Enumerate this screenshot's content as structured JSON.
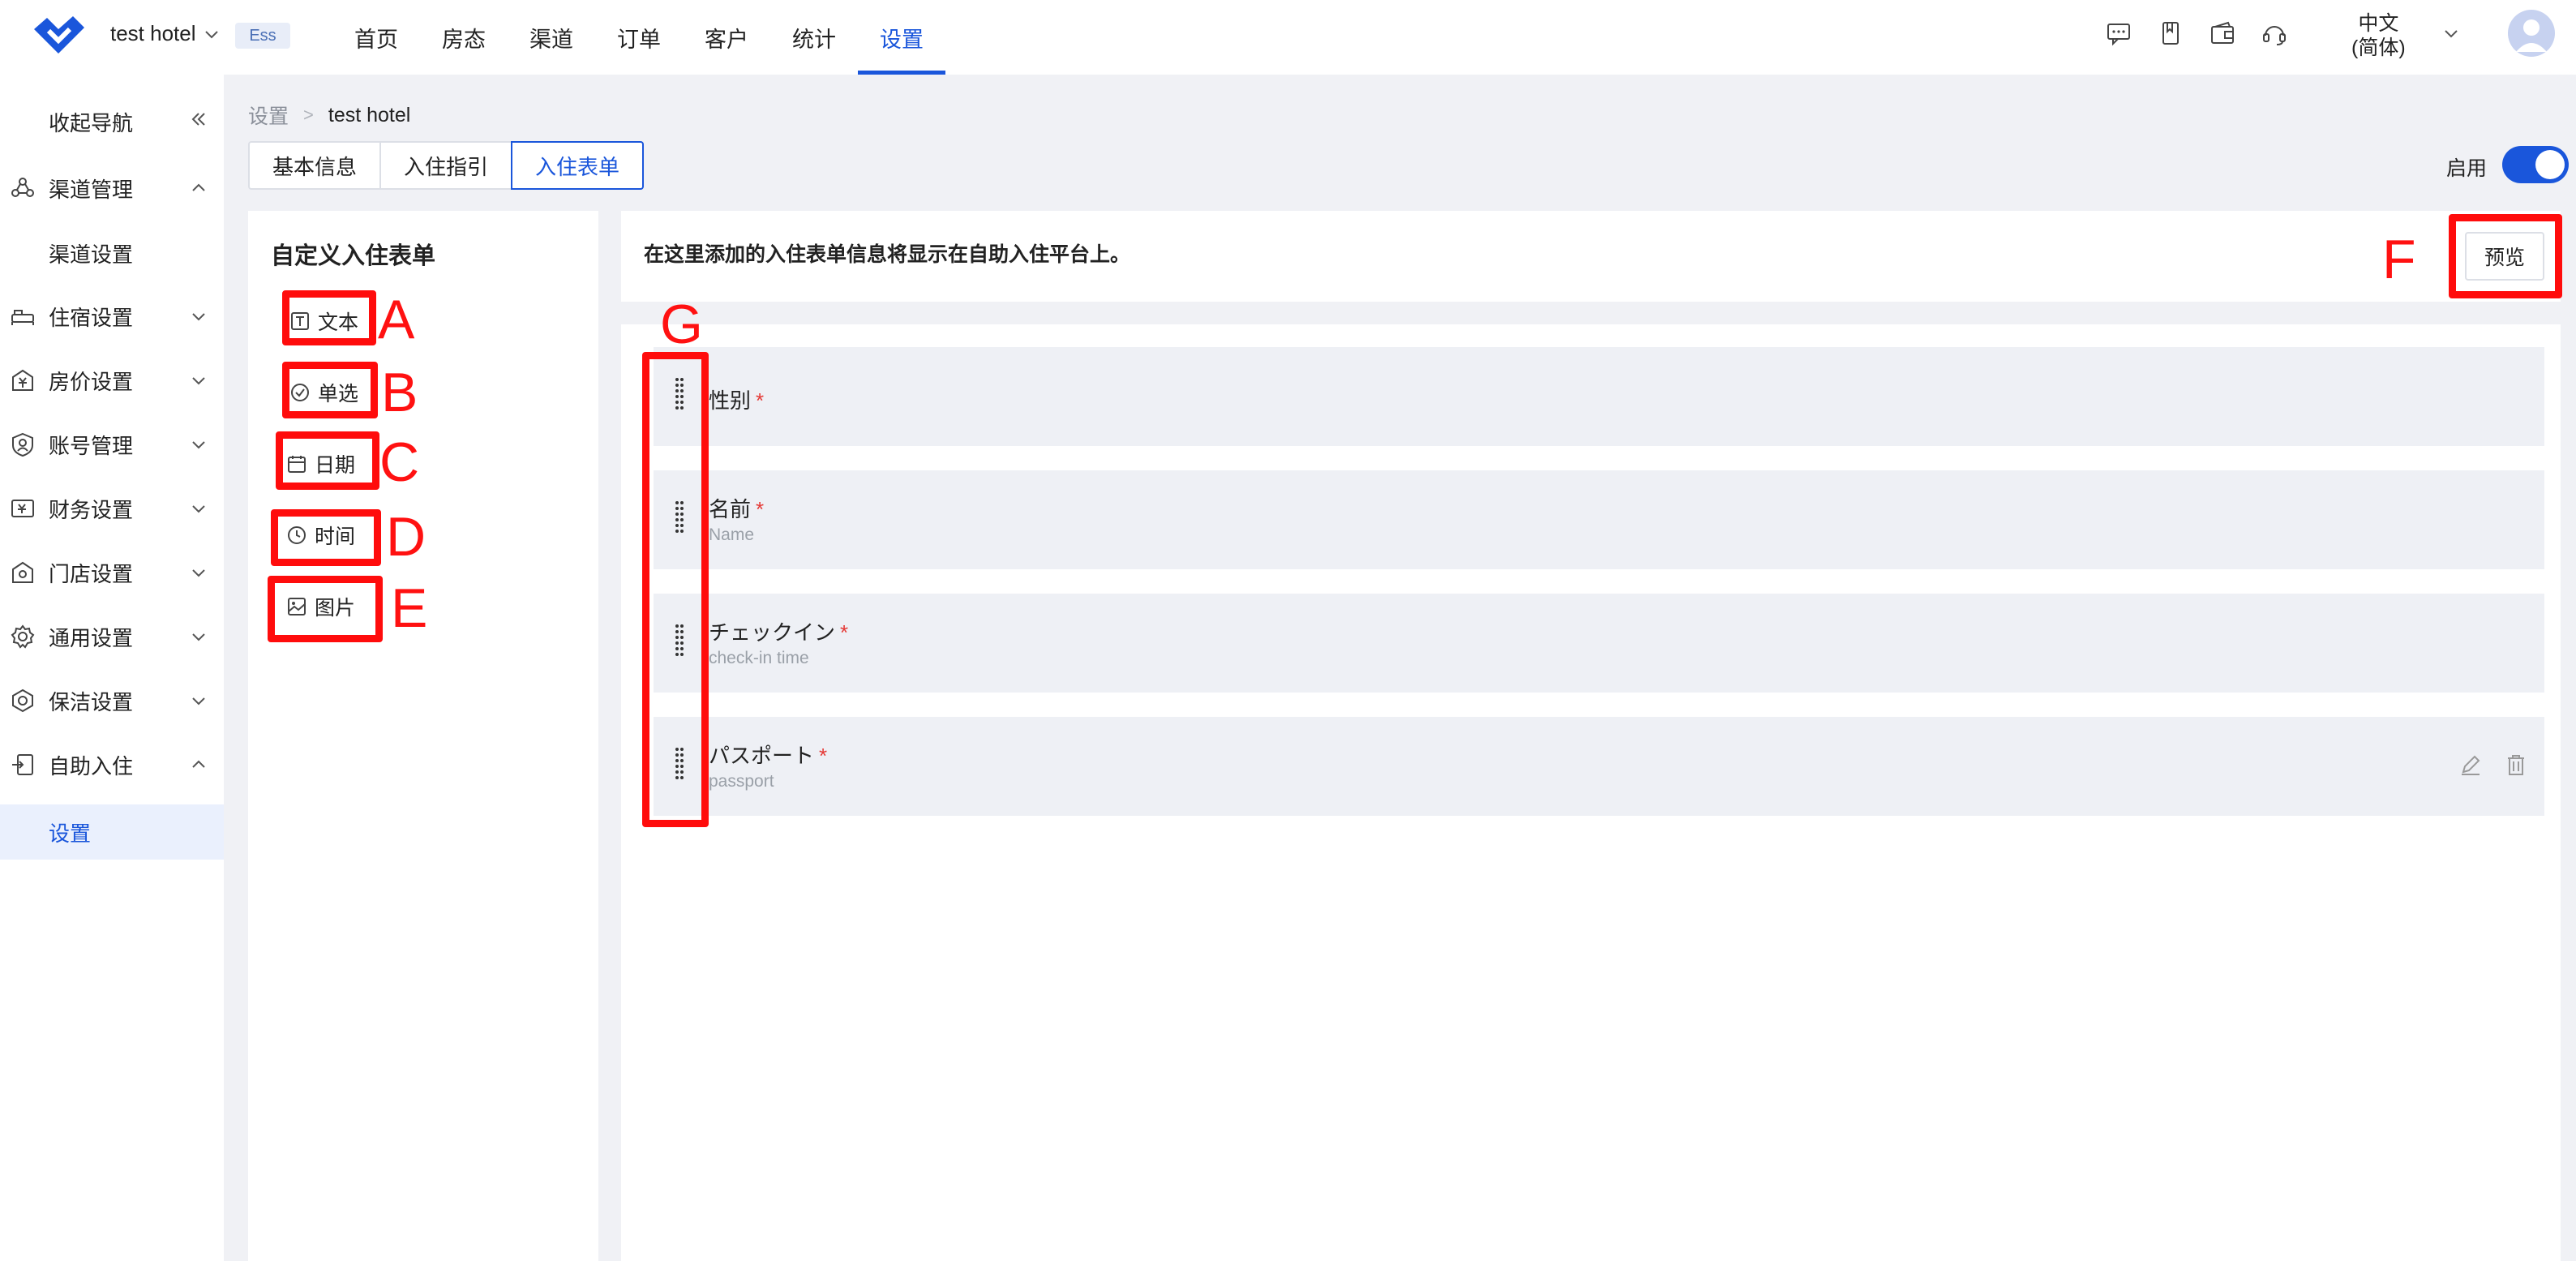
{
  "header": {
    "hotel_name": "test hotel",
    "badge": "Ess",
    "nav": [
      "首页",
      "房态",
      "渠道",
      "订单",
      "客户",
      "统计",
      "设置"
    ],
    "active_nav": "设置",
    "language_line1": "中文",
    "language_line2": "(简体)",
    "icons": [
      "message-icon",
      "bookmark-icon",
      "wallet-icon",
      "headset-icon"
    ]
  },
  "sidebar": {
    "collapse_label": "收起导航",
    "items": [
      {
        "label": "渠道管理",
        "icon": "channel-icon",
        "expanded": true
      },
      {
        "label": "渠道设置",
        "sub": true
      },
      {
        "label": "住宿设置",
        "icon": "bed-icon"
      },
      {
        "label": "房价设置",
        "icon": "price-icon"
      },
      {
        "label": "账号管理",
        "icon": "account-icon"
      },
      {
        "label": "财务设置",
        "icon": "finance-icon"
      },
      {
        "label": "门店设置",
        "icon": "store-icon"
      },
      {
        "label": "通用设置",
        "icon": "gear-icon"
      },
      {
        "label": "保洁设置",
        "icon": "cleaning-icon"
      },
      {
        "label": "自助入住",
        "icon": "self-checkin-icon",
        "expanded": true
      },
      {
        "label": "设置",
        "sub": true,
        "active": true
      }
    ]
  },
  "breadcrumb": {
    "root": "设置",
    "current": "test hotel"
  },
  "tabs": [
    "基本信息",
    "入住指引",
    "入住表单"
  ],
  "active_tab": "入住表单",
  "enable": {
    "label": "启用",
    "on": true
  },
  "left_panel": {
    "title": "自定义入住表单",
    "field_types": [
      {
        "label": "文本",
        "icon": "text-icon"
      },
      {
        "label": "单选",
        "icon": "radio-icon"
      },
      {
        "label": "日期",
        "icon": "calendar-icon"
      },
      {
        "label": "时间",
        "icon": "clock-icon"
      },
      {
        "label": "图片",
        "icon": "image-icon"
      }
    ]
  },
  "info_bar": {
    "text": "在这里添加的入住表单信息将显示在自助入住平台上。",
    "preview_label": "预览"
  },
  "form_fields": [
    {
      "label": "性别",
      "required": "*",
      "sub": ""
    },
    {
      "label": "名前",
      "required": "*",
      "sub": "Name"
    },
    {
      "label": "チェックイン",
      "required": "*",
      "sub": "check-in time"
    },
    {
      "label": "パスポート",
      "required": "*",
      "sub": "passport"
    }
  ],
  "annotations": [
    "A",
    "B",
    "C",
    "D",
    "E",
    "F",
    "G"
  ],
  "colors": {
    "accent": "#1a56db",
    "annotation": "#ff0c0c",
    "required": "#e53935"
  }
}
